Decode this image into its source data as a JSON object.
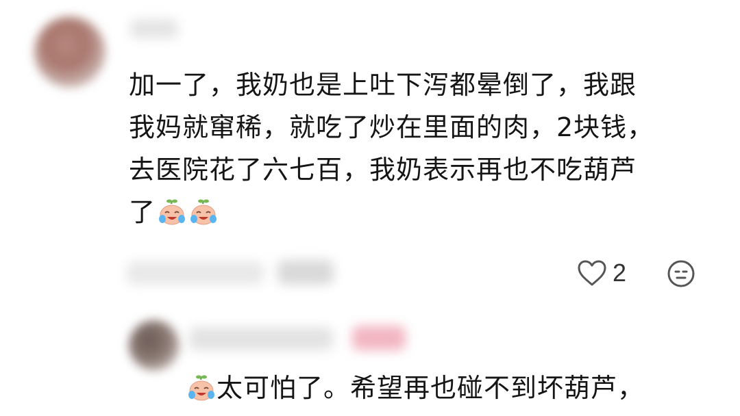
{
  "comment": {
    "lines": [
      "加一了，我奶也是上吐下泻都晕倒了，我跟",
      "我妈就窜稀，就吃了炒在里面的肉，2块钱，",
      "去医院花了六七百，我奶表示再也不吃葫芦",
      "了"
    ],
    "emoji": "crying-gourd-emoji",
    "likes": "2"
  },
  "reply": {
    "emoji": "crying-gourd-emoji",
    "text": "太可怕了。希望再也碰不到坏葫芦，"
  },
  "colors": {
    "text": "#151515",
    "icon": "#555555",
    "blur_pink": "#f2b6c2",
    "emoji_skin": "#f7c2a8"
  }
}
